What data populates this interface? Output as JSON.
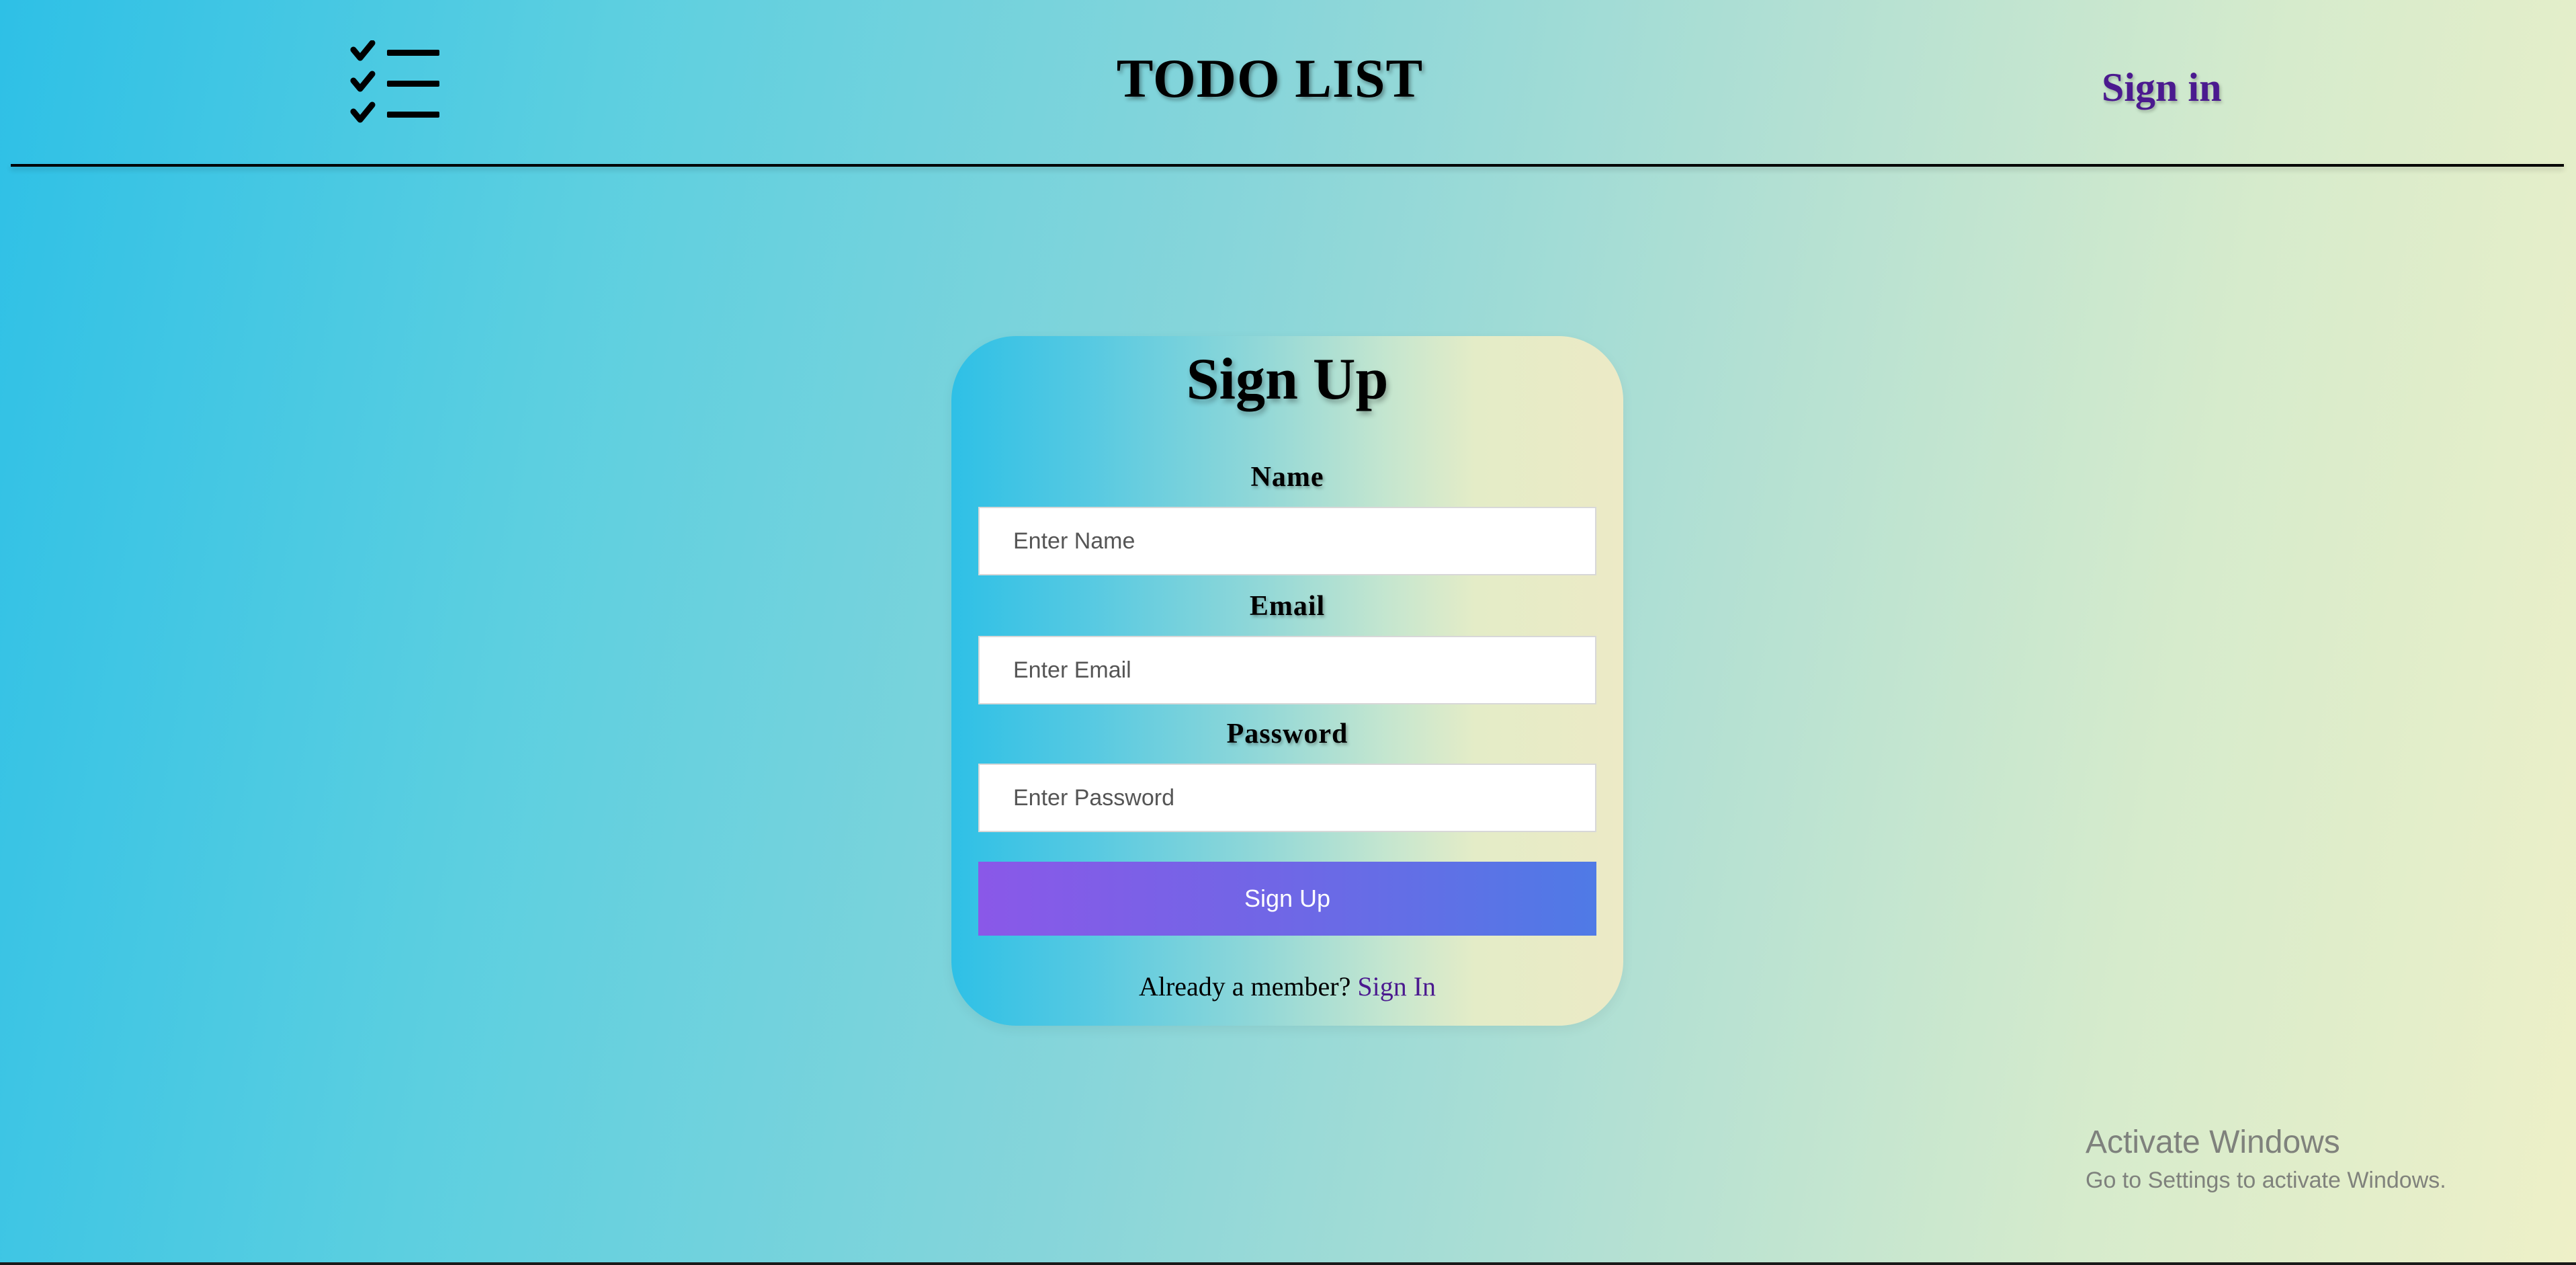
{
  "header": {
    "logo_icon": "checklist-icon",
    "title": "TODO LIST",
    "signin_label": "Sign in"
  },
  "form": {
    "title": "Sign Up",
    "name_label": "Name",
    "name_placeholder": "Enter Name",
    "email_label": "Email",
    "email_placeholder": "Enter Email",
    "password_label": "Password",
    "password_placeholder": "Enter Password",
    "submit_label": "Sign Up",
    "footer_text": "Already a member? ",
    "footer_link": "Sign In"
  },
  "watermark": {
    "title": "Activate Windows",
    "subtitle": "Go to Settings to activate Windows."
  },
  "colors": {
    "link": "#4b1a8f",
    "button_start": "#8a58e8",
    "button_end": "#4f7ae6",
    "background_start": "#2ec0e6",
    "background_end": "#eef0c8"
  }
}
